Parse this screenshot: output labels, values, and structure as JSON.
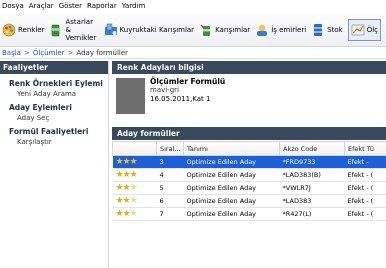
{
  "menu": [
    "Dosya",
    "Araçlar",
    "Göster",
    "Raporlar",
    "Yardım"
  ],
  "toolbar": {
    "buttons": [
      {
        "label": "Renkler",
        "icon": "palette-icon"
      },
      {
        "label": "Astarlar &\nVernikler",
        "icon": "can-icon"
      },
      {
        "label": "Kuyruktaki Karışımlar",
        "icon": "queue-icon"
      },
      {
        "label": "Karışımlar",
        "icon": "mix-icon"
      },
      {
        "label": "İş emirleri",
        "icon": "workorder-icon"
      },
      {
        "label": "Stok",
        "icon": "stock-icon"
      },
      {
        "label": "Ölç",
        "icon": "measure-icon"
      }
    ]
  },
  "breadcrumb": {
    "home": "Başla",
    "middle": "Ölçümler",
    "current": "Aday formüller"
  },
  "sidebar": {
    "header": "Faaliyetler",
    "groups": [
      {
        "title": "Renk Örnekleri Eylemi",
        "items": [
          "Yeni Aday Arama"
        ]
      },
      {
        "title": "Aday Eylemleri",
        "items": [
          "Aday Seç"
        ]
      },
      {
        "title": "Formül Faaliyetleri",
        "items": [
          "Karşılaştır"
        ]
      }
    ]
  },
  "info": {
    "header": "Renk Adayları bilgisi",
    "title": "Ölçümler Formülü",
    "subtitle": "mavi-gri",
    "meta": "16.05.2011,Kat 1"
  },
  "formulas": {
    "header": "Aday formüller",
    "columns": [
      "",
      "Sıral...",
      "Tanımı",
      "Akzo Code",
      "Efekt Tü"
    ],
    "rows": [
      {
        "stars": 3,
        "rank": "3",
        "desc": "Optimize Edilen Aday",
        "code": "*FRD9733",
        "effect": "Efekt -",
        "selected": true
      },
      {
        "stars": 3,
        "rank": "4",
        "desc": "Optimize Edilen Aday",
        "code": "*LAD383(B)",
        "effect": "Efekt - (",
        "selected": false
      },
      {
        "stars": 2,
        "rank": "5",
        "desc": "Optimize Edilen Aday",
        "code": "*VWLR7J",
        "effect": "Efekt - (",
        "selected": false
      },
      {
        "stars": 2,
        "rank": "6",
        "desc": "Optimize Edilen Aday",
        "code": "*LAD383",
        "effect": "Efekt - (",
        "selected": false
      },
      {
        "stars": 2,
        "rank": "7",
        "desc": "Optimize Edilen Aday",
        "code": "*R427(L)",
        "effect": "Efekt - (",
        "selected": false
      }
    ]
  },
  "colors": {
    "panel_header": "#39495e",
    "selection": "#1c5fd8",
    "link": "#1a56c4",
    "star": "#dcae16"
  }
}
